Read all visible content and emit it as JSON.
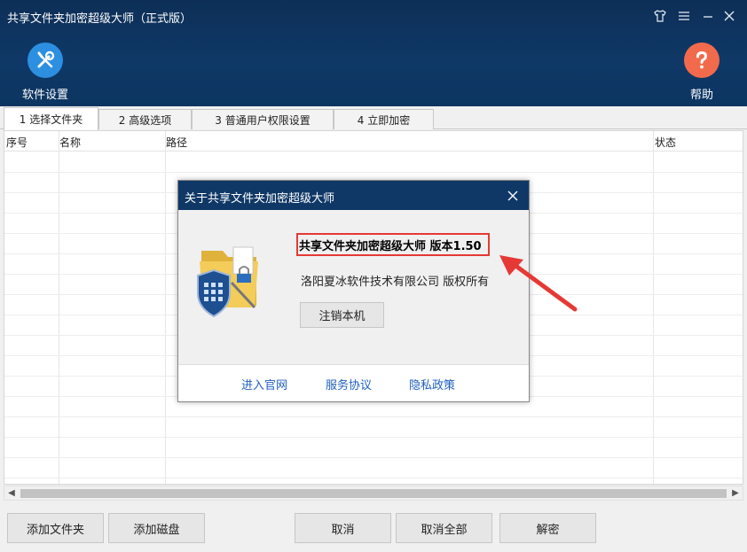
{
  "window": {
    "title": "共享文件夹加密超级大师（正式版）"
  },
  "toolbar": {
    "settings_label": "软件设置",
    "help_label": "帮助"
  },
  "tabs": [
    {
      "label": "1 选择文件夹"
    },
    {
      "label": "2 高级选项"
    },
    {
      "label": "3 普通用户权限设置"
    },
    {
      "label": "4 立即加密"
    }
  ],
  "table": {
    "columns": [
      "序号",
      "名称",
      "路径",
      "状态"
    ]
  },
  "buttons": {
    "add_folder": "添加文件夹",
    "add_disk": "添加磁盘",
    "cancel": "取消",
    "cancel_all": "取消全部",
    "decrypt": "解密"
  },
  "dialog": {
    "title": "关于共享文件夹加密超级大师",
    "product": "共享文件夹加密超级大师 版本1.50",
    "copyright": "洛阳夏冰软件技术有限公司 版权所有",
    "logout_button": "注销本机",
    "links": [
      "进入官网",
      "服务协议",
      "隐私政策"
    ]
  },
  "colors": {
    "header_bg": "#0f3866",
    "settings_icon_bg": "#2d8fe0",
    "help_icon_bg": "#f26a4c",
    "annotation_red": "#e53935",
    "link_blue": "#1f5fbf"
  },
  "icons": {
    "settings": "wrench-screwdriver-icon",
    "help": "question-mark-icon",
    "skin": "tshirt-icon",
    "menu": "hamburger-menu-icon",
    "minimize": "minimize-icon",
    "close": "close-icon",
    "product_logo": "folder-shield-lock-icon"
  }
}
